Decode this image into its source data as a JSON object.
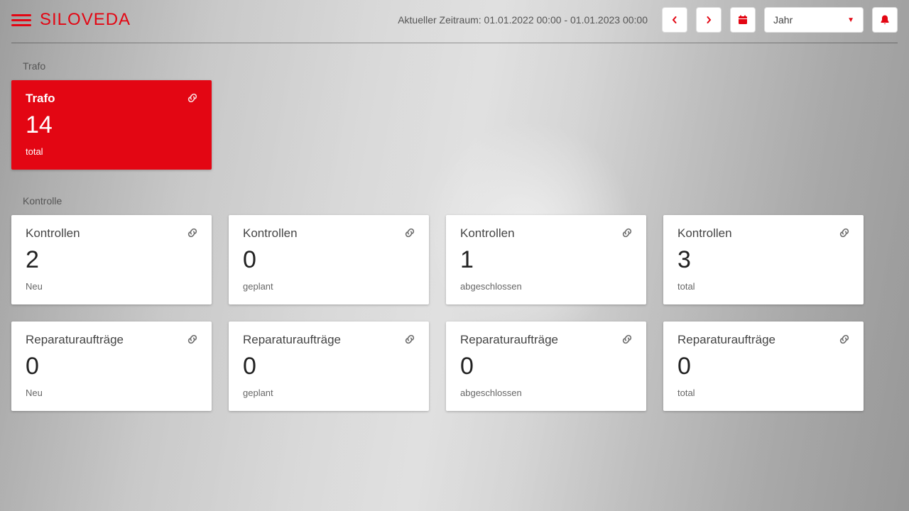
{
  "header": {
    "brand": "SILOVEDA",
    "timerange_label": "Aktueller Zeitraum: 01.01.2022 00:00 - 01.01.2023 00:00",
    "period_dropdown": "Jahr"
  },
  "colors": {
    "accent": "#e30613"
  },
  "sections": [
    {
      "title": "Trafo",
      "cards": [
        {
          "title": "Trafo",
          "value": "14",
          "sub": "total",
          "variant": "red"
        }
      ]
    },
    {
      "title": "Kontrolle",
      "cards": [
        {
          "title": "Kontrollen",
          "value": "2",
          "sub": "Neu",
          "variant": "white"
        },
        {
          "title": "Kontrollen",
          "value": "0",
          "sub": "geplant",
          "variant": "white"
        },
        {
          "title": "Kontrollen",
          "value": "1",
          "sub": "abgeschlossen",
          "variant": "white"
        },
        {
          "title": "Kontrollen",
          "value": "3",
          "sub": "total",
          "variant": "white"
        }
      ]
    },
    {
      "title": "",
      "cards": [
        {
          "title": "Reparaturaufträge",
          "value": "0",
          "sub": "Neu",
          "variant": "white"
        },
        {
          "title": "Reparaturaufträge",
          "value": "0",
          "sub": "geplant",
          "variant": "white"
        },
        {
          "title": "Reparaturaufträge",
          "value": "0",
          "sub": "abgeschlossen",
          "variant": "white"
        },
        {
          "title": "Reparaturaufträge",
          "value": "0",
          "sub": "total",
          "variant": "white"
        }
      ]
    }
  ]
}
